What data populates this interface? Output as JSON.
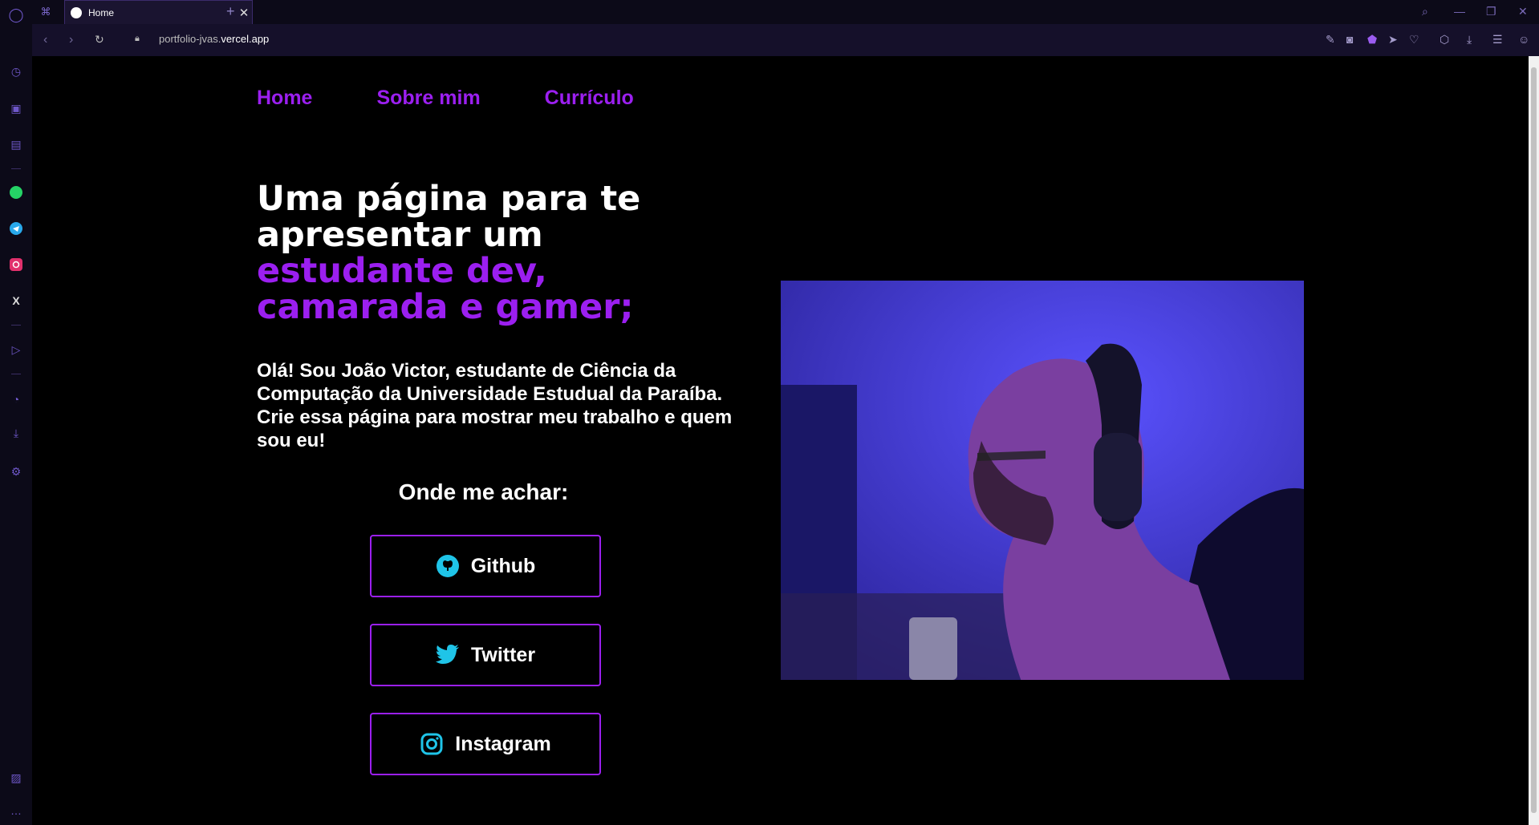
{
  "browser": {
    "tab_title": "Home",
    "url_prefix": "portfolio-jvas.",
    "url_domain": "vercel.app"
  },
  "nav": {
    "items": [
      "Home",
      "Sobre mim",
      "Currículo"
    ]
  },
  "hero": {
    "line1": "Uma página para te",
    "line2": "apresentar um",
    "accent1": "estudante dev,",
    "accent2": "camarada e gamer;"
  },
  "intro": "Olá! Sou João Victor, estudante de Ciência da Computação da Universidade Estudual da Paraíba. Crie essa página para mostrar meu trabalho e quem sou eu!",
  "find": {
    "title": "Onde me achar:",
    "links": [
      {
        "label": "Github",
        "icon": "github-icon"
      },
      {
        "label": "Twitter",
        "icon": "twitter-icon"
      },
      {
        "label": "Instagram",
        "icon": "instagram-icon"
      }
    ]
  },
  "colors": {
    "accent": "#9b1ff0",
    "background": "#000000"
  }
}
